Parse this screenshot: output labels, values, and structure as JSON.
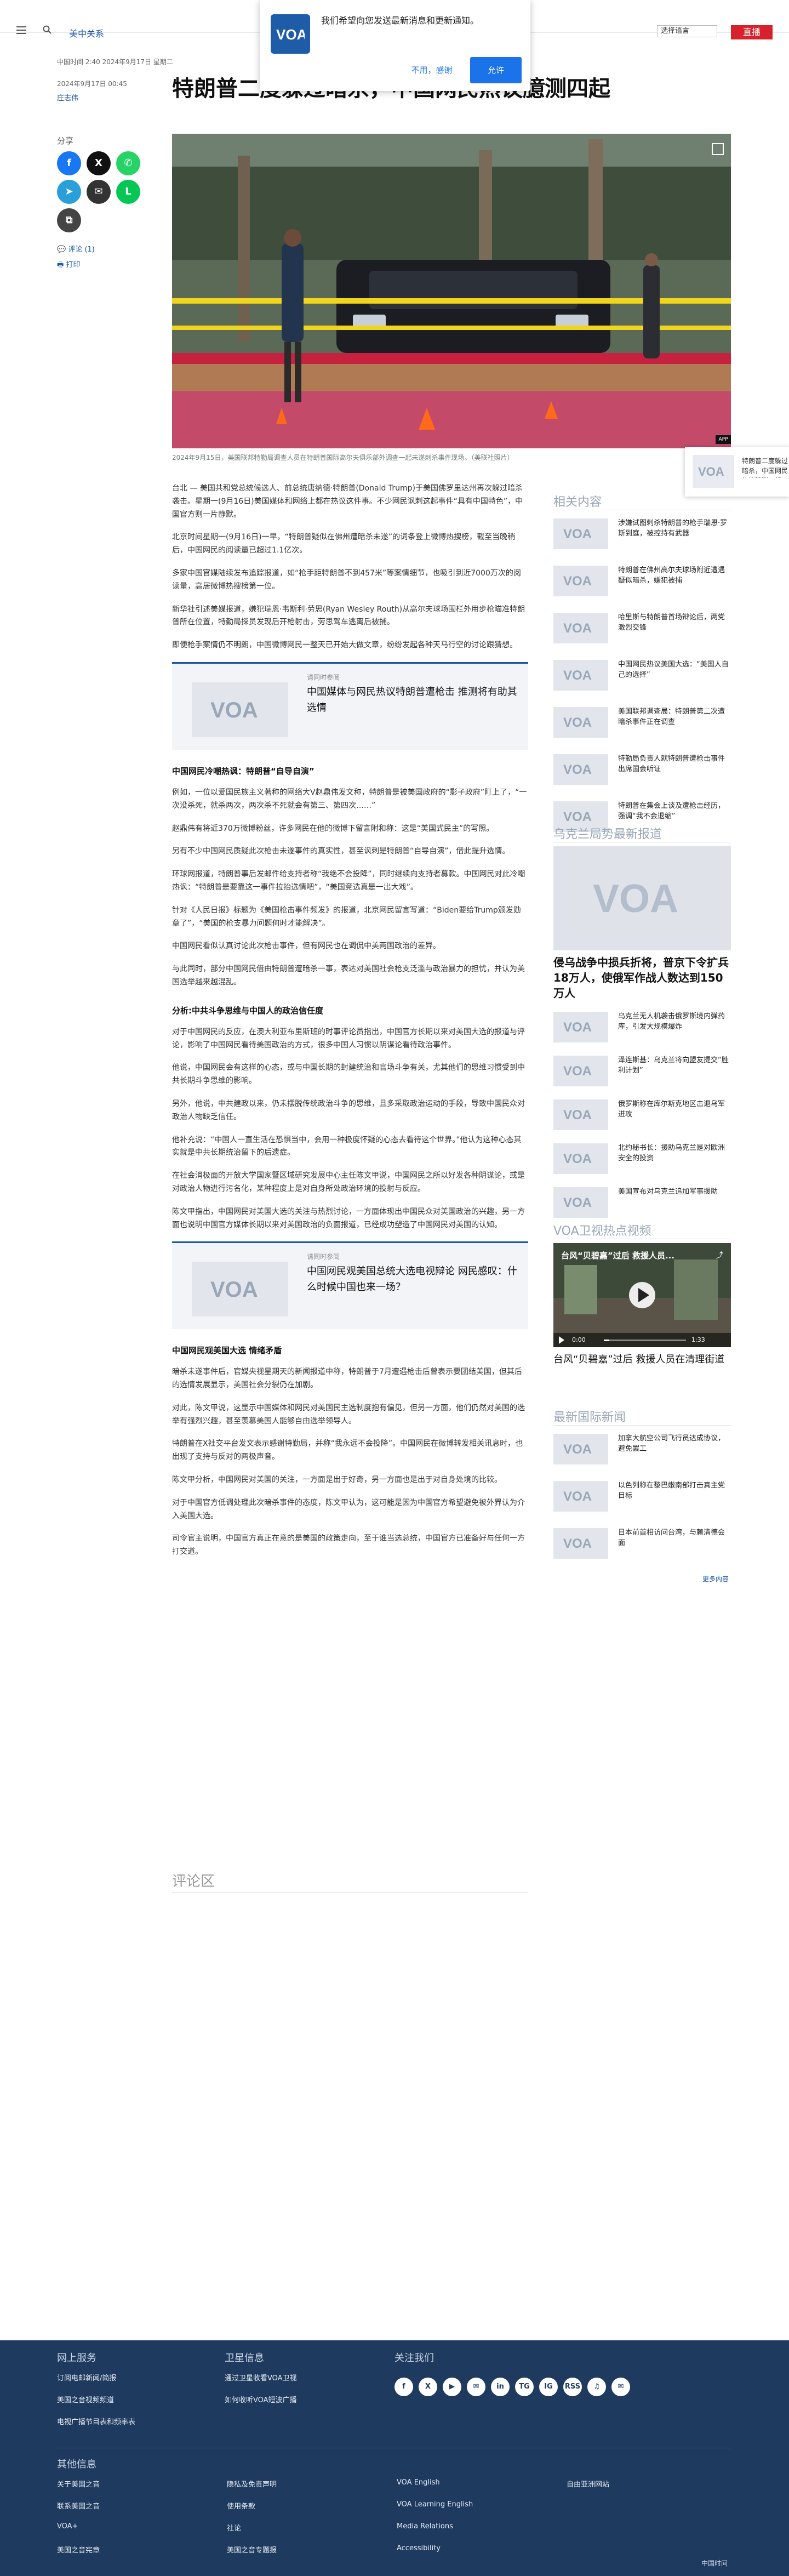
{
  "header": {
    "section": "美中关系",
    "language_select": "选择语言",
    "follow": "关注",
    "live": "直播"
  },
  "notification": {
    "message": "我们希望向您发送最新消息和更新通知。",
    "decline": "不用，感谢",
    "allow": "允许"
  },
  "article": {
    "time": "中国时间 2:40 2024年9月17日 星期二",
    "date": "2024年9月17日 00:45",
    "author": "庄志伟",
    "headline": "特朗普二度躲过暗杀，中国网民热议臆测四起",
    "caption": "2024年9月15日，美国联邦特勤局调查人员在特朗普国际高尔夫俱乐部外调查一起未遂刺杀事件现场。（美联社照片）",
    "app_badge": "APP",
    "share_label": "分享",
    "comments_link": "评论 (1)",
    "print_link": "打印",
    "paragraphs_a": [
      "台北 — 美国共和党总统候选人、前总统唐纳德·特朗普(Donald Trump)于美国佛罗里达州再次躲过暗杀袭击。星期一(9月16日)美国媒体和网络上都在热议这件事。不少网民讽刺这起事件“具有中国特色”，中国官方则一片静默。",
      "北京时间星期一(9月16日)一早，“特朗普疑似在佛州遭暗杀未遂”的词条登上微博热搜榜，截至当晚稍后，中国网民的阅读量已超过1.1亿次。",
      "多家中国官媒陆续发布追踪报道，如“枪手距特朗普不到457米”等案情细节，也吸引到近7000万次的阅读量，高居微博热搜榜第一位。",
      "新华社引述美媒报道，嫌犯瑞恩·韦斯利·劳思(Ryan Wesley Routh)从高尔夫球场围栏外用步枪瞄准特朗普所在位置，特勤局探员发现后开枪射击，劳思驾车逃离后被捕。",
      "即便枪手案情仍不明朗，中国微博网民一整天已开始大做文章，纷纷发起各种天马行空的讨论跟猜想。"
    ],
    "related1": {
      "kicker": "请同时参阅",
      "title": "中国媒体与网民热议特朗普遭枪击 推测将有助其选情"
    },
    "subhead1": "中国网民冷嘲热讽：特朗普“自导自演”",
    "paragraphs_b": [
      "例如，一位以爱国民族主义著称的网络大V赵鼎伟发文称，特朗普是被美国政府的“影子政府”盯上了，“一次没杀死，就杀两次，两次杀不死就会有第三、第四次……”",
      "赵鼎伟有将近370万微博粉丝，许多网民在他的微博下留言附和称：这是“美国式民主”的写照。",
      "另有不少中国网民质疑此次枪击未遂事件的真实性，甚至讽刺是特朗普“自导自演”，借此提升选情。",
      "环球网报道，特朗普事后发邮件给支持者称“我绝不会投降”，同时继续向支持者募款。中国网民对此冷嘲热讽：“特朗普是要靠这一事件拉抬选情吧”，“美国竞选真是一出大戏”。",
      "针对《人民日报》标题为《美国枪击事件频发》的报道，北京网民留言写道：“Biden要给Trump颁发勋章了”，“美国的枪支暴力问题何时才能解决”。",
      "中国网民看似认真讨论此次枪击事件，但有网民也在调侃中美两国政治的差异。",
      "与此同时，部分中国网民借由特朗普遭暗杀一事，表达对美国社会枪支泛滥与政治暴力的担忧，并认为美国选举越来越混乱。"
    ],
    "subhead2": "分析:中共斗争思维与中国人的政治信任度",
    "paragraphs_c": [
      "对于中国网民的反应，在澳大利亚布里斯班的时事评论员指出，中国官方长期以来对美国大选的报道与评论，影响了中国网民看待美国政治的方式，很多中国人习惯以阴谋论看待政治事件。",
      "他说，中国网民会有这样的心态，或与中国长期的封建统治和官场斗争有关，尤其他们的思维习惯受到中共长期斗争思维的影响。",
      "另外，他说，中共建政以来，仍未摆脱传统政治斗争的思维，且多采取政治运动的手段，导致中国民众对政治人物缺乏信任。",
      "他补充说：“中国人一直生活在恐惧当中，会用一种极度怀疑的心态去看待这个世界。”他认为这种心态其实就是中共长期统治留下的后遗症。",
      "在社会消极面的开放大学国家暨区域研究发展中心主任陈文甲说，中国网民之所以好发各种阴谋论，或是对政治人物进行污名化，某种程度上是对自身所处政治环境的投射与反应。",
      "陈文甲指出，中国网民对美国大选的关注与热烈讨论，一方面体现出中国民众对美国政治的兴趣，另一方面也说明中国官方媒体长期以来对美国政治的负面报道，已经成功塑造了中国网民对美国的认知。"
    ],
    "related2": {
      "kicker": "请同时参阅",
      "title": "中国网民观美国总统大选电视辩论 网民感叹：什么时候中国也来一场？"
    },
    "subhead3": "中国网民观美国大选 情绪矛盾",
    "paragraphs_d": [
      "暗杀未遂事件后，官媒央视星期天的新闻报道中称，特朗普于7月遭遇枪击后曾表示要团结美国，但其后的选情发展显示，美国社会分裂仍在加剧。",
      "对此，陈文甲说，这显示中国媒体和网民对美国民主选制度抱有偏见，但另一方面，他们仍然对美国的选举有强烈兴趣，甚至羡慕美国人能够自由选举领导人。",
      "特朗普在X社交平台发文表示感谢特勤局，并称“我永远不会投降”。中国网民在微博转发相关讯息时，也出现了支持与反对的两极声音。",
      "陈文甲分析，中国网民对美国的关注，一方面是出于好奇，另一方面也是出于对自身处境的比较。",
      "对于中国官方低调处理此次暗杀事件的态度，陈文甲认为，这可能是因为中国官方希望避免被外界认为介入美国大选。",
      "司令官主说明，中国官方真正在意的是美国的政策走向，至于谁当选总统，中国官方已准备好与任何一方打交道。"
    ],
    "comments_title": "评论区"
  },
  "promo": {
    "text": "特朗普二度躲过暗杀，中国网民热议臆测四起"
  },
  "sidebar": {
    "related_title": "相关内容",
    "related": [
      "涉嫌试图刺杀特朗普的枪手瑞恩·罗斯到庭，被控持有武器",
      "特朗普在佛州高尔夫球场附近遭遇疑似暗杀，嫌犯被捕",
      "哈里斯与特朗普首场辩论后，两党激烈交锋",
      "中国网民热议美国大选：“美国人自己的选择”",
      "美国联邦调查局：特朗普第二次遭暗杀事件正在调查",
      "特勤局负责人就特朗普遭枪击事件出席国会听证",
      "特朗普在集会上谈及遭枪击经历，强调“我不会退缩”"
    ],
    "ukraine_title": "乌克兰局势最新报道",
    "feature_title": "侵乌战争中损兵折将，普京下令扩兵18万人，使俄军作战人数达到150万人",
    "ukraine": [
      "乌克兰无人机袭击俄罗斯境内弹药库，引发大规模爆炸",
      "泽连斯基：乌克兰将向盟友提交“胜利计划”",
      "俄罗斯称在库尔斯克地区击退乌军进攻",
      "北约秘书长：援助乌克兰是对欧洲安全的投资",
      "美国宣布对乌克兰追加军事援助"
    ],
    "video_title": "VOA卫视热点视频",
    "video_overlay": "台风“贝碧嘉”过后 救援人员...",
    "video_time": "0:00",
    "video_duration": "1:33",
    "video_caption": "台风“贝碧嘉”过后 救援人员在清理街道",
    "intl_title": "最新国际新闻",
    "intl": [
      "加拿大航空公司飞行员达成协议，避免罢工",
      "以色列称在黎巴嫩南部打击真主党目标",
      "日本前首相访问台湾，与赖清德会面"
    ],
    "more": "更多内容"
  },
  "footer": {
    "online_title": "网上服务",
    "online": [
      "订阅电邮新闻/简报",
      "美国之音视频频道",
      "电视广播节目表和频率表"
    ],
    "sat_title": "卫星信息",
    "sat": [
      "通过卫星收看VOA卫视",
      "如何收听VOA短波广播"
    ],
    "follow_title": "关注我们",
    "social": [
      "f",
      "X",
      "▶",
      "✉",
      "in",
      "TG",
      "IG",
      "RSS",
      "♫",
      "✉"
    ],
    "other_title": "其他信息",
    "other": [
      "关于美国之音",
      "联系美国之音",
      "VOA+",
      "美国之音宪章",
      "隐私及免责声明",
      "使用条款",
      "社论",
      "美国之音专题报",
      "VOA English",
      "VOA Learning English",
      "Media Relations",
      "Accessibility",
      "自由亚洲网站"
    ],
    "copyright": "中国时间"
  }
}
